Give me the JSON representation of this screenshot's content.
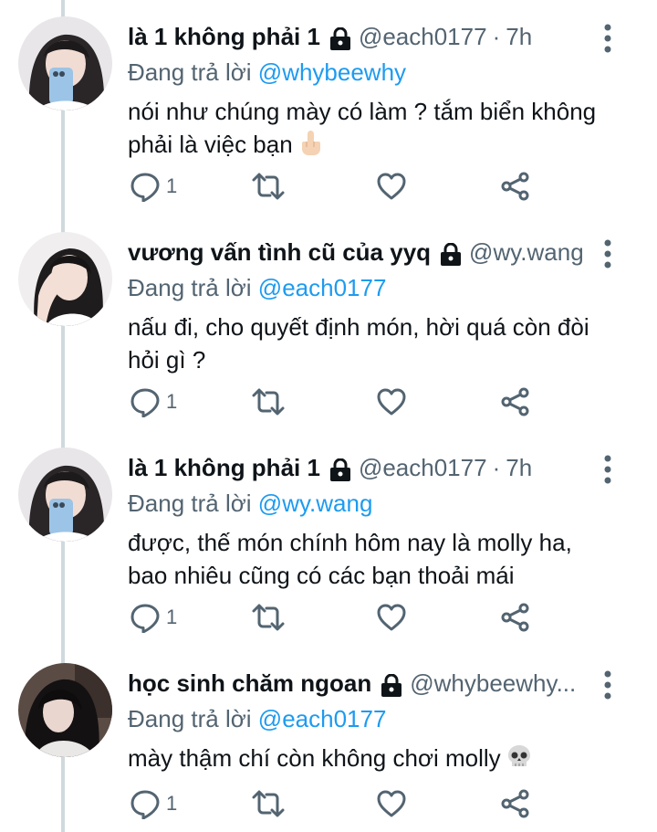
{
  "replies": [
    {
      "name": "là 1 không phải 1",
      "handle": "@each0177",
      "separator": "·",
      "time": "7h",
      "replying_label": "Đang trả lời",
      "replying_to": "@whybeewhy",
      "text": "nói như chúng mày có làm ? tắm biển không phải là việc bạn",
      "emoji": "middle-finger",
      "reply_count": "1",
      "avatar": "girl-with-phone"
    },
    {
      "name": "vương vấn tình cũ của yyq",
      "handle": "@wy.wang",
      "separator": "",
      "time": "",
      "replying_label": "Đang trả lời",
      "replying_to": "@each0177",
      "text": "nấu đi, cho quyết định món, hời quá còn đòi hỏi gì ?",
      "emoji": "",
      "reply_count": "1",
      "avatar": "girl-hand-on-face"
    },
    {
      "name": "là 1 không phải 1",
      "handle": "@each0177",
      "separator": "·",
      "time": "7h",
      "replying_label": "Đang trả lời",
      "replying_to": "@wy.wang",
      "text": "được, thế món chính hôm nay là molly ha, bao nhiêu cũng có các bạn thoải mái",
      "emoji": "",
      "reply_count": "1",
      "avatar": "girl-with-phone"
    },
    {
      "name": "học sinh chăm ngoan",
      "handle": "@whybeewhy...",
      "separator": "",
      "time": "",
      "replying_label": "Đang trả lời",
      "replying_to": "@each0177",
      "text": "mày thậm chí còn không chơi molly",
      "emoji": "skull",
      "reply_count": "1",
      "avatar": "girl-dark-hair"
    }
  ],
  "colors": {
    "text": "#0f1419",
    "secondary": "#536471",
    "accent": "#1d9bf0",
    "thread_line": "#cfd9de"
  },
  "icons": [
    "lock-icon",
    "more-icon",
    "reply-icon",
    "retweet-icon",
    "like-icon",
    "share-icon"
  ]
}
